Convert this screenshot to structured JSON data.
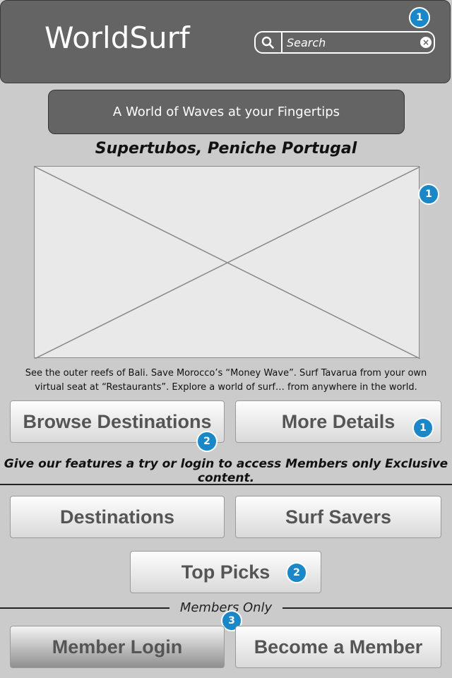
{
  "header": {
    "logo": "WorldSurf",
    "search_placeholder": "Search",
    "badge": "1"
  },
  "tagline": "A World of Waves at your Fingertips",
  "feature": {
    "title": "Supertubos, Peniche Portugal",
    "image_badge": "1",
    "description_line1": "See the outer reefs of Bali. Save Morocco’s “Money Wave”. Surf Tavarua from your own",
    "description_line2": "virtual seat at “Restaurants”. Explore a world of surf… from anywhere in the world."
  },
  "actions": {
    "browse": "Browse Destinations",
    "browse_badge": "2",
    "details": "More Details",
    "details_badge": "1"
  },
  "note": "Give our features a try or login to access Members only Exclusive content.",
  "features": {
    "destinations": "Destinations",
    "surf_savers": "Surf Savers",
    "top_picks": "Top Picks",
    "top_picks_badge": "2"
  },
  "members": {
    "label": "Members Only",
    "badge": "3",
    "login": "Member Login",
    "become": "Become a Member"
  },
  "colors": {
    "header_bg": "#646464",
    "page_bg": "#cbcbcb",
    "badge_blue": "#1a87c8"
  }
}
